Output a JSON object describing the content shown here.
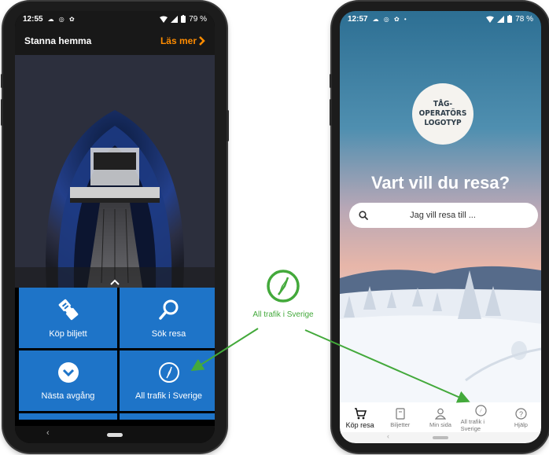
{
  "left_phone": {
    "status": {
      "time": "12:55",
      "battery": "79 %"
    },
    "header": {
      "title": "Stanna hemma",
      "link": "Läs mer"
    },
    "tiles": [
      {
        "label": "Köp biljett",
        "icon": "ticket-icon"
      },
      {
        "label": "Sök resa",
        "icon": "search-icon"
      },
      {
        "label": "Nästa avgång",
        "icon": "chevron-down-icon"
      },
      {
        "label": "All trafik i Sverige",
        "icon": "compass-icon"
      }
    ],
    "nav": {
      "back": "‹"
    }
  },
  "right_phone": {
    "status": {
      "time": "12:57",
      "battery": "78 %"
    },
    "logo": {
      "line1": "TÅG-",
      "line2": "OPERATÖRS",
      "line3": "LOGOTYP"
    },
    "headline": "Vart vill du resa?",
    "search_placeholder": "Jag vill resa till ...",
    "tabs": [
      {
        "label": "Köp resa",
        "icon": "cart-icon"
      },
      {
        "label": "Biljetter",
        "icon": "ticket-icon"
      },
      {
        "label": "Min sida",
        "icon": "person-icon"
      },
      {
        "label": "All trafik i Sverige",
        "icon": "compass-icon"
      },
      {
        "label": "Hjälp",
        "icon": "help-icon"
      }
    ],
    "nav": {
      "back": "‹"
    }
  },
  "annotation": {
    "label": "All trafik i Sverige",
    "icon": "compass-icon"
  },
  "colors": {
    "tile_blue": "#1e74c8",
    "link_orange": "#ff8c00",
    "annotation_green": "#43a93b"
  }
}
